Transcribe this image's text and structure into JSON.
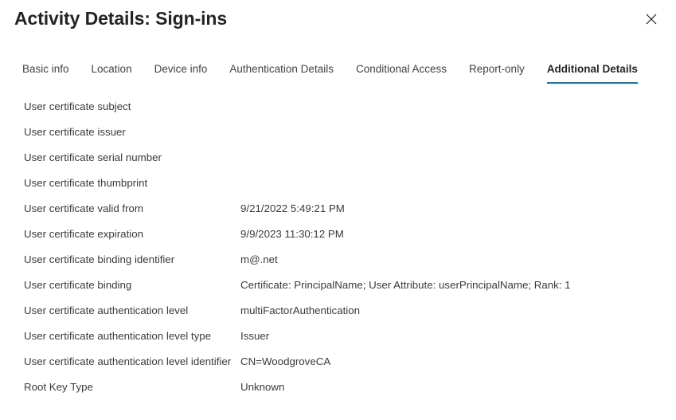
{
  "header": {
    "title": "Activity Details: Sign-ins",
    "close_label": "Close",
    "close_icon": "close-icon"
  },
  "tabs": [
    {
      "label": "Basic info",
      "active": false
    },
    {
      "label": "Location",
      "active": false
    },
    {
      "label": "Device info",
      "active": false
    },
    {
      "label": "Authentication Details",
      "active": false
    },
    {
      "label": "Conditional Access",
      "active": false
    },
    {
      "label": "Report-only",
      "active": false
    },
    {
      "label": "Additional Details",
      "active": true
    }
  ],
  "details": [
    {
      "label": "User certificate subject",
      "value": ""
    },
    {
      "label": "User certificate issuer",
      "value": ""
    },
    {
      "label": "User certificate serial number",
      "value": ""
    },
    {
      "label": "User certificate thumbprint",
      "value": ""
    },
    {
      "label": "User certificate valid from",
      "value": "9/21/2022 5:49:21 PM"
    },
    {
      "label": "User certificate expiration",
      "value": "9/9/2023 11:30:12 PM"
    },
    {
      "label": "User certificate binding identifier",
      "value": "m@.net"
    },
    {
      "label": "User certificate binding",
      "value": "Certificate: PrincipalName; User Attribute: userPrincipalName; Rank: 1"
    },
    {
      "label": "User certificate authentication level",
      "value": "multiFactorAuthentication"
    },
    {
      "label": "User certificate authentication level type",
      "value": "Issuer"
    },
    {
      "label": "User certificate authentication level identifier",
      "value": "CN=WoodgroveCA"
    },
    {
      "label": "Root Key Type",
      "value": "Unknown"
    }
  ],
  "colors": {
    "accent": "#0f7ac4",
    "background": "#ffffff",
    "text": "#3b3a39",
    "title_text": "#242424"
  }
}
